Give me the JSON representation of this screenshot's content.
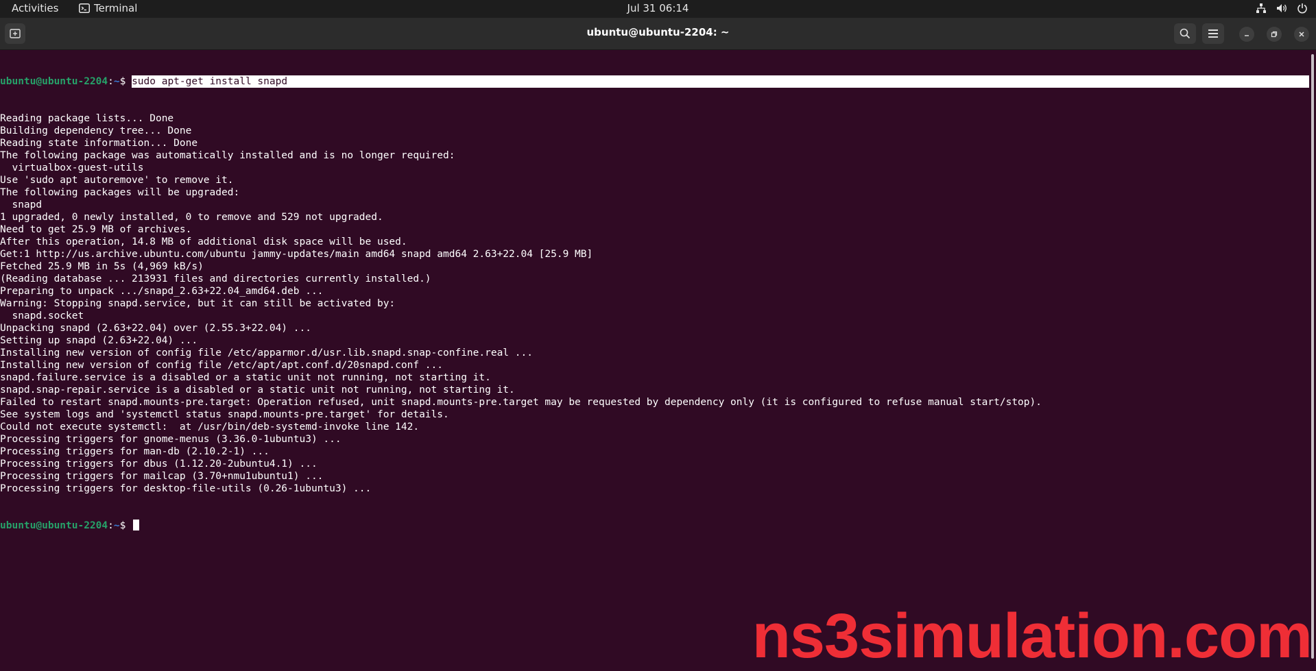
{
  "topbar": {
    "activities": "Activities",
    "app_name": "Terminal",
    "clock": "Jul 31  06:14",
    "tray_icons": [
      "network-icon",
      "volume-icon",
      "power-icon"
    ]
  },
  "window": {
    "title": "ubuntu@ubuntu-2204: ~",
    "buttons": [
      "new-tab-icon",
      "search-icon",
      "menu-icon",
      "minimize-icon",
      "restore-icon",
      "close-icon"
    ]
  },
  "terminal": {
    "prompt_user": "ubuntu@ubuntu-2204",
    "prompt_sep": ":",
    "prompt_path": "~",
    "prompt_symbol": "$ ",
    "command": "sudo apt-get install snapd",
    "output": [
      "Reading package lists... Done",
      "Building dependency tree... Done",
      "Reading state information... Done",
      "The following package was automatically installed and is no longer required:",
      "  virtualbox-guest-utils",
      "Use 'sudo apt autoremove' to remove it.",
      "The following packages will be upgraded:",
      "  snapd",
      "1 upgraded, 0 newly installed, 0 to remove and 529 not upgraded.",
      "Need to get 25.9 MB of archives.",
      "After this operation, 14.8 MB of additional disk space will be used.",
      "Get:1 http://us.archive.ubuntu.com/ubuntu jammy-updates/main amd64 snapd amd64 2.63+22.04 [25.9 MB]",
      "Fetched 25.9 MB in 5s (4,969 kB/s)",
      "(Reading database ... 213931 files and directories currently installed.)",
      "Preparing to unpack .../snapd_2.63+22.04_amd64.deb ...",
      "Warning: Stopping snapd.service, but it can still be activated by:",
      "  snapd.socket",
      "Unpacking snapd (2.63+22.04) over (2.55.3+22.04) ...",
      "Setting up snapd (2.63+22.04) ...",
      "Installing new version of config file /etc/apparmor.d/usr.lib.snapd.snap-confine.real ...",
      "Installing new version of config file /etc/apt/apt.conf.d/20snapd.conf ...",
      "snapd.failure.service is a disabled or a static unit not running, not starting it.",
      "snapd.snap-repair.service is a disabled or a static unit not running, not starting it.",
      "Failed to restart snapd.mounts-pre.target: Operation refused, unit snapd.mounts-pre.target may be requested by dependency only (it is configured to refuse manual start/stop).",
      "See system logs and 'systemctl status snapd.mounts-pre.target' for details.",
      "Could not execute systemctl:  at /usr/bin/deb-systemd-invoke line 142.",
      "Processing triggers for gnome-menus (3.36.0-1ubuntu3) ...",
      "Processing triggers for man-db (2.10.2-1) ...",
      "Processing triggers for dbus (1.12.20-2ubuntu4.1) ...",
      "Processing triggers for mailcap (3.70+nmu1ubuntu1) ...",
      "Processing triggers for desktop-file-utils (0.26-1ubuntu3) ..."
    ]
  },
  "watermark": "ns3simulation.com",
  "colors": {
    "terminal_bg": "#300a24",
    "prompt_user": "#26a269",
    "prompt_path": "#3a7bd5",
    "watermark": "#ef2e36"
  }
}
